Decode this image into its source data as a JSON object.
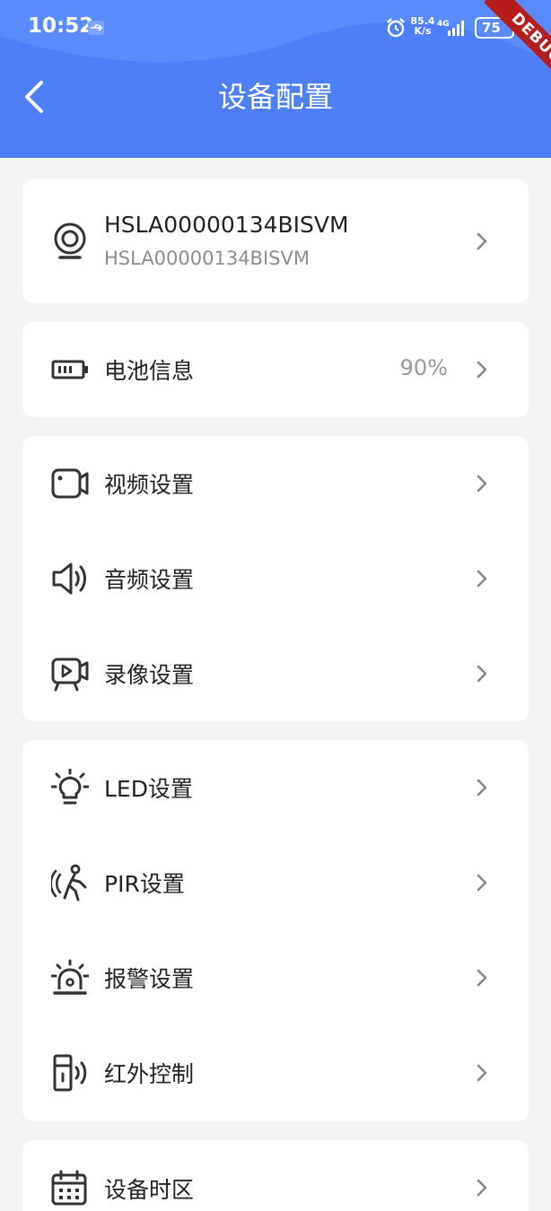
{
  "status_bar": {
    "time": "10:52",
    "net_speed_value": "85.4",
    "net_speed_unit": "K/s",
    "network_type": "4G",
    "battery": "75",
    "debug_label": "DEBUG"
  },
  "header": {
    "title": "设备配置",
    "color": "#4f7ff7"
  },
  "device": {
    "name": "HSLA00000134BISVM",
    "id": "HSLA00000134BISVM"
  },
  "battery_info": {
    "label": "电池信息",
    "value": "90%"
  },
  "media_settings": [
    {
      "label": "视频设置",
      "icon": "video-camera-icon"
    },
    {
      "label": "音频设置",
      "icon": "speaker-icon"
    },
    {
      "label": "录像设置",
      "icon": "recording-icon"
    }
  ],
  "hardware_settings": [
    {
      "label": "LED设置",
      "icon": "light-bulb-icon"
    },
    {
      "label": "PIR设置",
      "icon": "motion-sensor-icon"
    },
    {
      "label": "报警设置",
      "icon": "alarm-siren-icon"
    },
    {
      "label": "红外控制",
      "icon": "infrared-remote-icon"
    }
  ],
  "time_settings": [
    {
      "label": "设备时区",
      "icon": "calendar-icon"
    }
  ]
}
